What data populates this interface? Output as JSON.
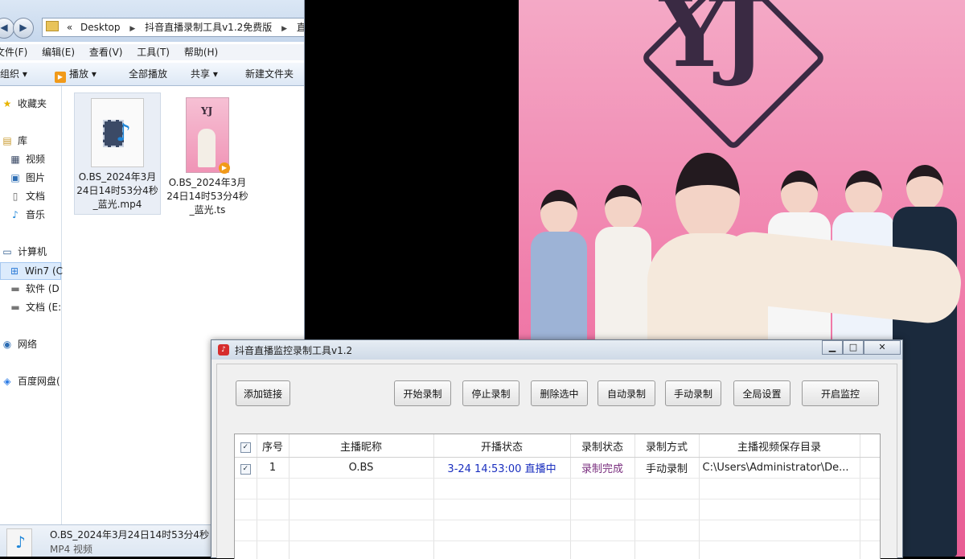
{
  "explorer": {
    "breadcrumb": [
      "Desktop",
      "抖音直播录制工具v1.2免费版",
      "直播"
    ],
    "breadcrumb_prefix": "«",
    "menu": [
      "文件(F)",
      "编辑(E)",
      "查看(V)",
      "工具(T)",
      "帮助(H)"
    ],
    "toolbar": {
      "organize": "组织",
      "play": "播放",
      "play_all": "全部播放",
      "share": "共享",
      "new_folder": "新建文件夹"
    },
    "nav": {
      "favorites": "收藏夹",
      "libraries": "库",
      "videos": "视频",
      "pictures": "图片",
      "documents": "文档",
      "music": "音乐",
      "computer": "计算机",
      "drive_c": "Win7 (C",
      "drive_d": "软件 (D",
      "drive_e": "文档 (E:",
      "network": "网络",
      "baidu": "百度网盘("
    },
    "files": [
      {
        "name": "O.BS_2024年3月24日14时53分4秒_蓝光.mp4"
      },
      {
        "name": "O.BS_2024年3月24日14时53分4秒_蓝光.ts"
      }
    ],
    "details": {
      "name": "O.BS_2024年3月24日14时53分4秒",
      "type": "MP4 视频"
    }
  },
  "video": {
    "logo": "YJ"
  },
  "recorder": {
    "title": "抖音直播监控录制工具v1.2",
    "buttons": {
      "add_link": "添加链接",
      "start_record": "开始录制",
      "stop_record": "停止录制",
      "delete_selected": "删除选中",
      "auto_record": "自动录制",
      "manual_record": "手动录制",
      "global_settings": "全局设置",
      "start_monitor": "开启监控"
    },
    "table": {
      "headers": [
        "序号",
        "主播昵称",
        "开播状态",
        "录制状态",
        "录制方式",
        "主播视频保存目录"
      ],
      "rows": [
        {
          "checked": true,
          "index": "1",
          "nickname": "O.BS",
          "live_status": "3-24 14:53:00 直播中",
          "record_status": "录制完成",
          "record_mode": "手动录制",
          "save_dir": "C:\\Users\\Administrator\\De..."
        }
      ]
    }
  },
  "colors": {
    "live_status": "#1a2fbf",
    "record_status": "#7a2f7f",
    "stage_pink": "#f07ba9"
  }
}
